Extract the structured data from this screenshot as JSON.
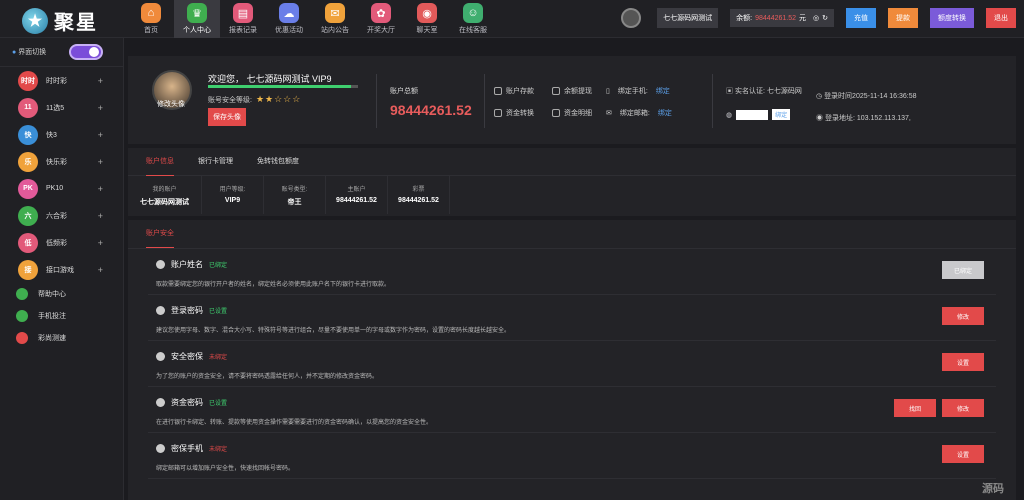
{
  "brand": {
    "name": "聚星",
    "logo_char": "★"
  },
  "nav": [
    {
      "label": "首页",
      "color": "#f08a3b",
      "glyph": "⌂"
    },
    {
      "label": "个人中心",
      "color": "#3fae4f",
      "glyph": "♛"
    },
    {
      "label": "报表记录",
      "color": "#e25a7a",
      "glyph": "▤"
    },
    {
      "label": "优惠活动",
      "color": "#6a7ee8",
      "glyph": "☁"
    },
    {
      "label": "站内公告",
      "color": "#f0a23b",
      "glyph": "✉"
    },
    {
      "label": "开奖大厅",
      "color": "#e25a7a",
      "glyph": "✿"
    },
    {
      "label": "聊天室",
      "color": "#e25a5a",
      "glyph": "◉"
    },
    {
      "label": "在线客服",
      "color": "#3fae6f",
      "glyph": "☺"
    }
  ],
  "top": {
    "username": "七七源码网测试",
    "balance_label": "余额:",
    "balance_value": "98444261.52",
    "balance_unit": "元",
    "charge": "充值",
    "withdraw": "提款",
    "transfer": "额度转换",
    "logout": "退出"
  },
  "sidebar": {
    "theme_label": "界面切换",
    "games": [
      {
        "label": "时时彩",
        "color": "#e24a4a",
        "short": "时时"
      },
      {
        "label": "11选5",
        "color": "#e25a7a",
        "short": "11"
      },
      {
        "label": "快3",
        "color": "#3a8fd8",
        "short": "快"
      },
      {
        "label": "快乐彩",
        "color": "#f0a23b",
        "short": "乐"
      },
      {
        "label": "PK10",
        "color": "#e25a9a",
        "short": "PK"
      },
      {
        "label": "六合彩",
        "color": "#3fae4f",
        "short": "六"
      },
      {
        "label": "低频彩",
        "color": "#e25a7a",
        "short": "低"
      },
      {
        "label": "接口游戏",
        "color": "#f0a23b",
        "short": "接"
      }
    ],
    "links": [
      {
        "label": "帮助中心",
        "color": "#3fae4f"
      },
      {
        "label": "手机投注",
        "color": "#3fae4f"
      },
      {
        "label": "彩尚测速",
        "color": "#e24a4a"
      }
    ]
  },
  "profile": {
    "avatar_label": "修改头像",
    "welcome": "欢迎您， 七七源码网测试 VIP9",
    "progress": 0.95,
    "security_level_label": "账号安全等级:",
    "stars": "★★☆☆☆",
    "save_avatar": "保存头像",
    "total_label": "账户总额",
    "total_value": "98444261.52",
    "quick": [
      "账户存款",
      "余额提现",
      "资金转换",
      "资金明细"
    ],
    "bind_phone_label": "绑定手机:",
    "bind_phone_link": "绑定",
    "bind_email_label": "绑定邮箱:",
    "bind_email_link": "绑定",
    "realname": "实名认证: 七七源码网",
    "qq_btn": "绑定",
    "login_time": "登录时间2025-11-14 16:36:58",
    "login_addr": "登录地址: 103.152.113.137,"
  },
  "tabs": [
    "账户信息",
    "银行卡管理",
    "免转钱包额度"
  ],
  "info": [
    {
      "k": "我的账户",
      "v": "七七源码网测试"
    },
    {
      "k": "用户等级:",
      "v": "VIP9"
    },
    {
      "k": "账号类型:",
      "v": "帝王"
    },
    {
      "k": "主账户",
      "v": "98444261.52"
    },
    {
      "k": "彩票",
      "v": "98444261.52"
    }
  ],
  "security": {
    "tab": "账户安全",
    "items": [
      {
        "title": "账户姓名",
        "status": "已绑定",
        "ok": true,
        "desc": "取款需要绑定您的银行开户者的姓名，绑定姓名必须使用此账户名下的银行卡进行取款。",
        "btn": "已绑定"
      },
      {
        "title": "登录密码",
        "status": "已设置",
        "ok": true,
        "desc": "建议您使用字母、数字、混合大小写、特殊符号等进行组合，尽量不要使用单一的字母或数字作为密码，设置的密码长度越长越安全。",
        "btn": "修改"
      },
      {
        "title": "安全密保",
        "status": "未绑定",
        "ok": false,
        "desc": "为了您的账户的资金安全，请不要将密码透露给任何人，并不定期的修改资金密码。",
        "btn": "设置"
      },
      {
        "title": "资金密码",
        "status": "已设置",
        "ok": true,
        "desc": "在进行银行卡绑定、转账、提款等使用资金操作需要需要进行的资金密码确认，以提高您的资金安全性。",
        "btn": "修改",
        "btn2": "找回"
      },
      {
        "title": "密保手机",
        "status": "未绑定",
        "ok": false,
        "desc": "绑定邮箱可以增加账户安全性，快速找回帐号密码。",
        "btn": "设置"
      }
    ]
  },
  "watermark": "源码"
}
